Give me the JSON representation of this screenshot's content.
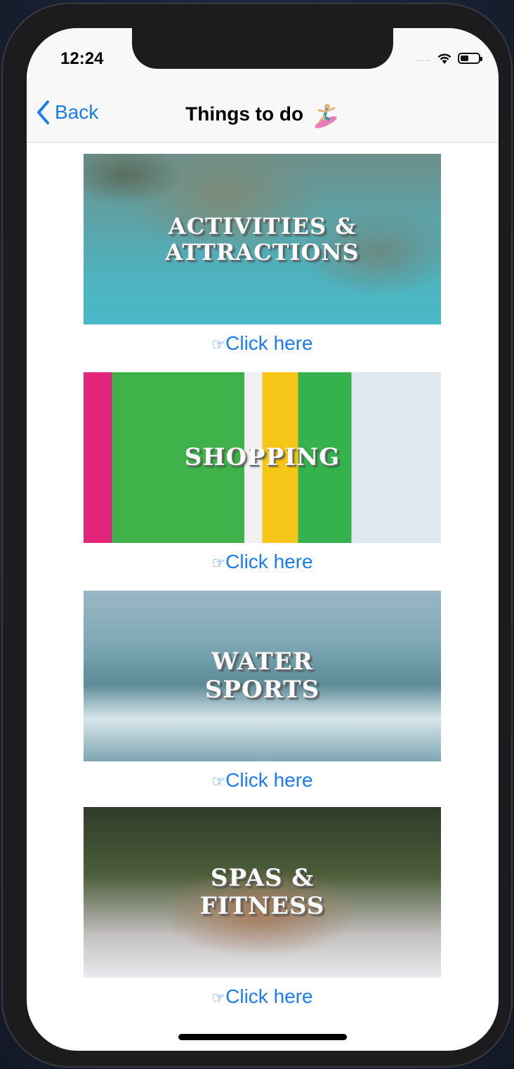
{
  "status": {
    "time": "12:24",
    "signal": "....."
  },
  "nav": {
    "back_label": "Back",
    "title": "Things to do"
  },
  "cards": [
    {
      "banner": "ACTIVITIES &\nATTRACTIONS",
      "link": "Click here",
      "hand": "☞"
    },
    {
      "banner": "SHOPPING",
      "link": "Click here",
      "hand": "☞"
    },
    {
      "banner": "WATER\nSPORTS",
      "link": "Click here",
      "hand": "☞"
    },
    {
      "banner": "SPAS &\nFITNESS",
      "link": "Click here",
      "hand": "☞"
    }
  ],
  "colors": {
    "accent": "#1a7cf0",
    "nav_bg": "#f8f8f8"
  },
  "icons": {
    "back": "chevron-left-icon",
    "title_emoji": "surfer-icon",
    "wifi": "wifi-icon",
    "battery": "battery-icon"
  },
  "battery_level": 0.45
}
